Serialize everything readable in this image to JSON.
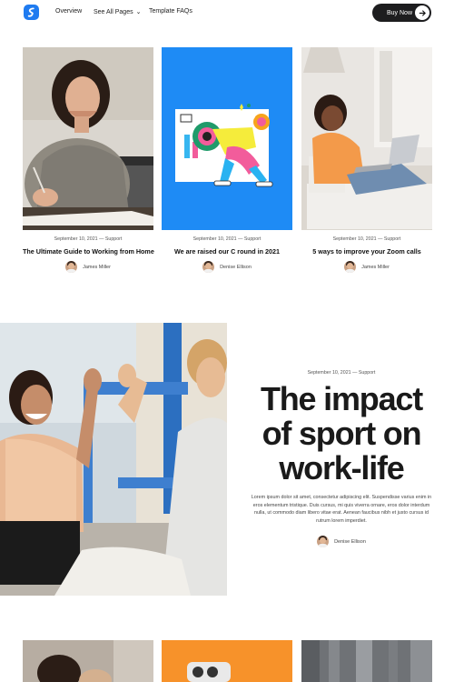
{
  "nav": {
    "logo_icon": "brand-s-logo",
    "links": [
      "Overview",
      "See All Pages",
      "Template FAQs"
    ],
    "buy_label": "Buy Now"
  },
  "cards": [
    {
      "meta": "September 10, 2021 — Support",
      "title": "The Ultimate Guide to Working from Home",
      "author": "James Miller"
    },
    {
      "meta": "September 10, 2021 — Support",
      "title": "We are raised our C round in 2021",
      "author": "Denise Ellison"
    },
    {
      "meta": "September 10, 2021 — Support",
      "title": "5 ways to improve your Zoom calls",
      "author": "James Miller"
    }
  ],
  "feature": {
    "meta": "September 10, 2021 — Support",
    "title": "The impact of sport on work-life",
    "body": "Lorem ipsum dolor sit amet, consectetur adipiscing elit. Suspendisse varius enim in eros elementum tristique. Duis cursus, mi quis viverra ornare, eros dolor interdum nulla, ut commodo diam libero vitae erat. Aenean faucibus nibh et justo cursus id rutrum lorem imperdiet.",
    "author": "Denise Ellison"
  },
  "colors": {
    "brand": "#1f7bf0",
    "card2_bg": "#1e8bf5",
    "bottom2_bg": "#f7922a"
  }
}
